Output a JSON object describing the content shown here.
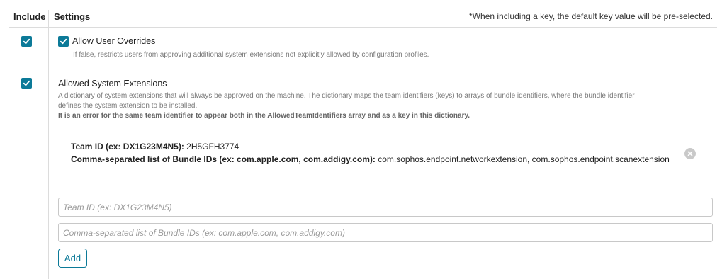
{
  "header": {
    "include_label": "Include",
    "settings_label": "Settings",
    "note": "*When including a key, the default key value will be pre-selected."
  },
  "settings": {
    "allow_user_overrides": {
      "checked": true,
      "label": "Allow User Overrides",
      "help": "If false, restricts users from approving additional system extensions not explicitly allowed by configuration profiles."
    },
    "allowed_system_extensions": {
      "checked": true,
      "label": "Allowed System Extensions",
      "help_line1": "A dictionary of system extensions that will always be approved on the machine. The dictionary maps the team identifiers (keys) to arrays of bundle identifiers, where the bundle identifier",
      "help_line2": "defines the system extension to be installed.",
      "help_bold": "It is an error for the same team identifier to appear both in the AllowedTeamIdentifiers array and as a key in this dictionary."
    }
  },
  "entry": {
    "team_id_label": "Team ID (ex: DX1G23M4N5):",
    "team_id_value": "2H5GFH3774",
    "bundle_ids_label": "Comma-separated list of Bundle IDs (ex: com.apple.com, com.addigy.com):",
    "bundle_ids_value": "com.sophos.endpoint.networkextension, com.sophos.endpoint.scanextension",
    "remove_icon": "close-circle-icon"
  },
  "form": {
    "team_id_placeholder": "Team ID (ex: DX1G23M4N5)",
    "team_id_value": "",
    "bundle_ids_placeholder": "Comma-separated list of Bundle IDs (ex: com.apple.com, com.addigy.com)",
    "bundle_ids_value": "",
    "add_label": "Add"
  },
  "colors": {
    "accent": "#0c7a98",
    "border": "#c8c8c8",
    "muted_text": "#7a7a7a"
  }
}
